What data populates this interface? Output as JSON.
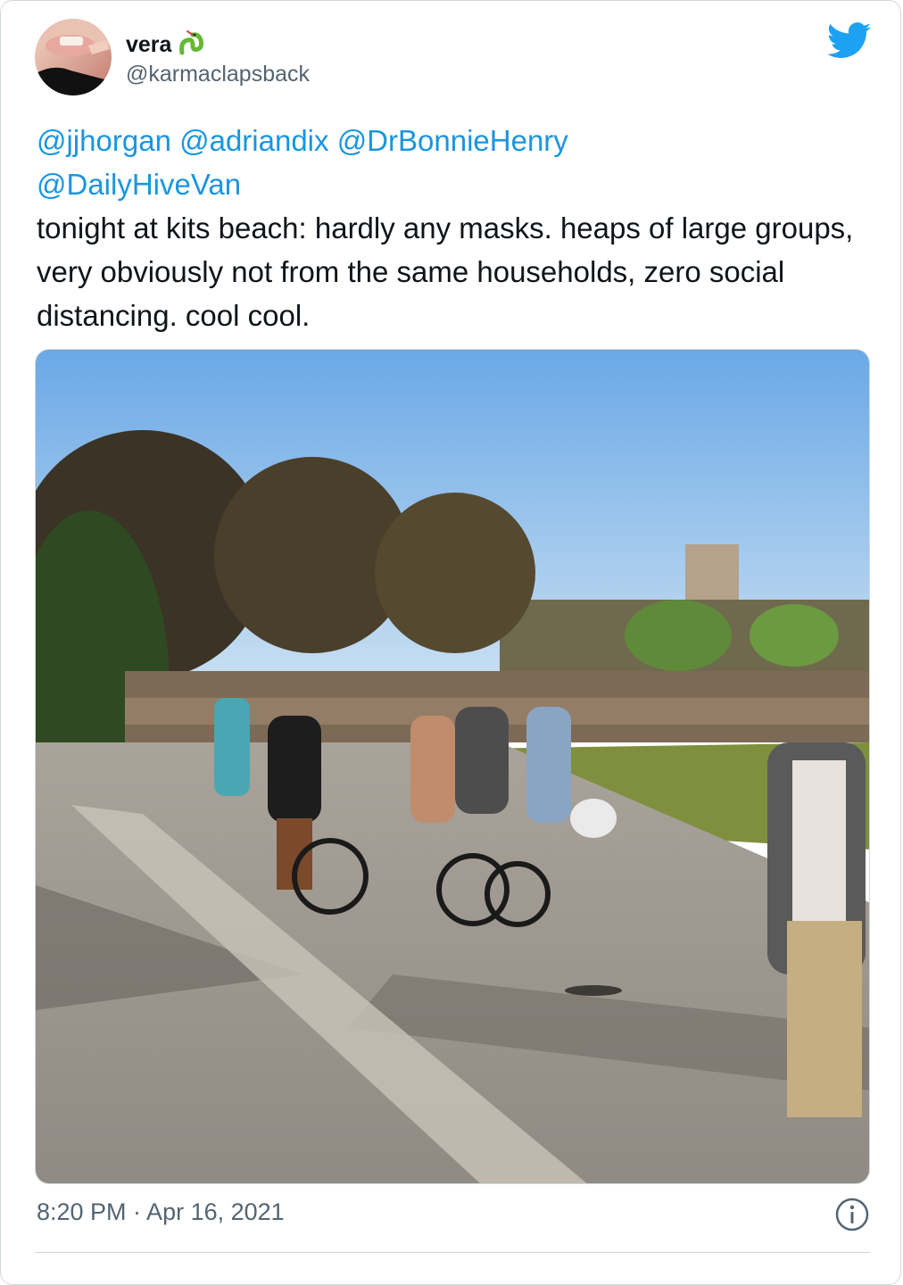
{
  "tweet": {
    "display_name": "vera",
    "handle": "@karmaclapsback",
    "mentions": [
      "@jjhorgan",
      "@adriandix",
      "@DrBonnieHenry",
      "@DailyHiveVan"
    ],
    "body": "tonight at kits beach: hardly any masks. heaps of large groups, very obviously not from the same households, zero social distancing. cool cool.",
    "timestamp": "8:20 PM · Apr 16, 2021"
  },
  "icons": {
    "verified_emoji": "snake-emoji-icon",
    "brand": "twitter-bird-icon",
    "info": "info-icon"
  },
  "colors": {
    "link": "#1b95e0",
    "text": "#0f1419",
    "muted": "#536471",
    "twitter_blue": "#1da1f2",
    "border": "#cfd9de"
  }
}
